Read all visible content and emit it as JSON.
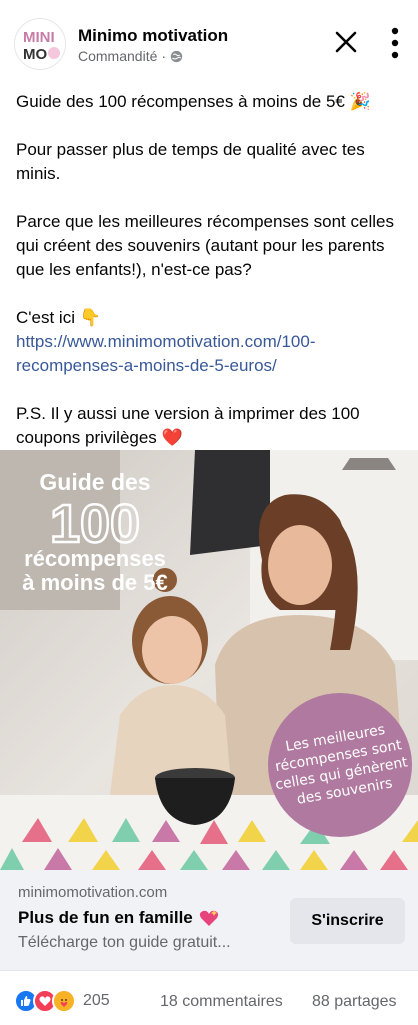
{
  "colors": {
    "link": "#385898",
    "brand_pink": "#b07aa0",
    "secondary_text": "#65676b",
    "cta_background": "#f0f2f5"
  },
  "header": {
    "page_name": "Minimo motivation",
    "sponsored_label": "Commandité",
    "separator": "·",
    "privacy_icon": "globe-icon",
    "close_icon": "close-icon",
    "more_icon": "more-vertical-icon",
    "avatar_logo": {
      "line1": "MINI",
      "line2": "MO"
    }
  },
  "post": {
    "line1": "Guide des 100 récompenses à moins de 5€",
    "line1_emoji": "🎉",
    "para2": "Pour passer plus de temps de qualité avec tes minis.",
    "para3": "Parce que les meilleures récompenses sont celles qui créent des souvenirs (autant pour les parents que les enfants!), n'est-ce pas?",
    "cest_ici": "C'est ici",
    "cest_ici_emoji": "👇",
    "link": "https://www.minimomotivation.com/100-recompenses-a-moins-de-5-euros/",
    "ps": "P.S. Il y aussi une version à imprimer des 100 coupons privilèges",
    "ps_emoji": "❤️"
  },
  "ad_image": {
    "title_line1": "Guide des",
    "title_number": "100",
    "title_line3": "récompenses",
    "title_line4": "à moins de 5€",
    "badge_line1": "Les meilleures",
    "badge_line2": "récompenses sont",
    "badge_line3": "celles qui génèrent",
    "badge_line4": "des souvenirs"
  },
  "cta": {
    "domain": "minimomotivation.com",
    "headline": "Plus de fun en famille",
    "headline_icon": "sparkling-heart-icon",
    "description": "Télécharge ton guide gratuit...",
    "button_label": "S'inscrire"
  },
  "engagement": {
    "reaction_icons": [
      "like-icon",
      "love-icon",
      "care-icon"
    ],
    "reactions_count": "205",
    "comments": "18 commentaires",
    "shares": "88 partages"
  }
}
